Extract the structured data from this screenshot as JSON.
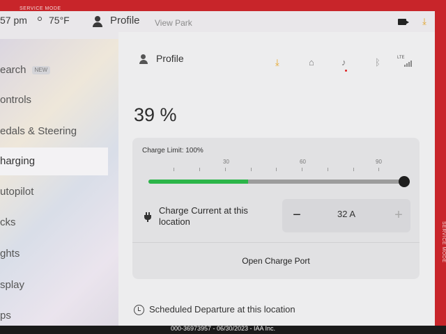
{
  "service_mode": {
    "top": "SERVICE MODE",
    "side": "SERVICE MODE"
  },
  "statusbar": {
    "time": "57 pm",
    "temperature": "75°F",
    "profile": "Profile",
    "view_mode": "View Park",
    "icons": [
      "user-icon",
      "thermometer-icon",
      "camera-icon",
      "download-icon"
    ]
  },
  "sidebar": {
    "items": [
      {
        "label": "earch",
        "badge": "NEW"
      },
      {
        "label": "ontrols"
      },
      {
        "label": "edals & Steering"
      },
      {
        "label": "harging",
        "active": true
      },
      {
        "label": "utopilot"
      },
      {
        "label": "cks"
      },
      {
        "label": "ghts"
      },
      {
        "label": "splay"
      },
      {
        "label": "ps"
      }
    ]
  },
  "header": {
    "profile_label": "Profile",
    "icons": [
      "download-icon",
      "garage-icon",
      "bell-icon",
      "bluetooth-icon",
      "lte-signal-icon"
    ],
    "lte_label": "LTE",
    "accent_color": "#e5a21d",
    "alert_dot_color": "#d22222"
  },
  "charging": {
    "battery_percent": "39 %",
    "charge_limit_label": "Charge Limit: 100%",
    "charge_limit_value": 100,
    "slider_ticks": [
      "30",
      "60",
      "90"
    ],
    "battery_level": 0.39,
    "fill_color": "#2cb549",
    "charge_current_label": "Charge Current at this location",
    "charge_current_value": "32 A",
    "minus_label": "−",
    "plus_label": "+",
    "open_port_label": "Open Charge Port"
  },
  "scheduled": {
    "label": "Scheduled Departure at this location"
  },
  "watermark": "000-36973957 - 06/30/2023 - IAA Inc."
}
